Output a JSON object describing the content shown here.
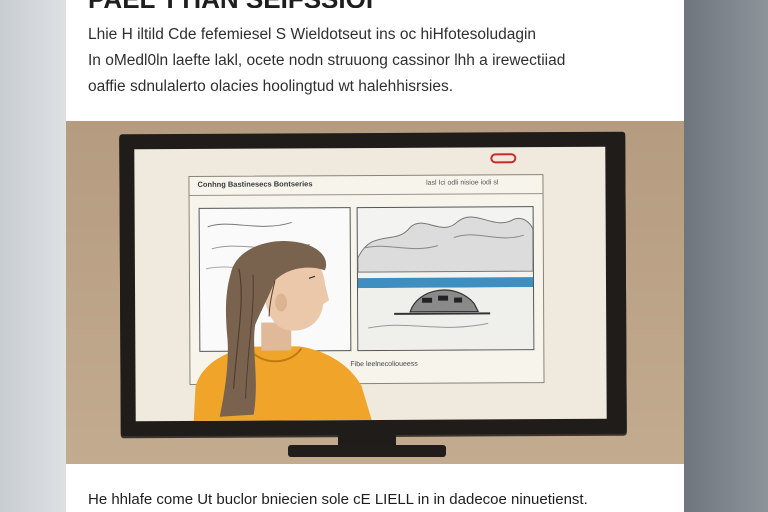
{
  "article": {
    "heading_partial": "PAEL TTIAN SEIFSSIOI",
    "lead_lines": [
      "Lhie  H iltild  Cde  fefemiesel S Wieldotseut ins oc hiHfotesoludagin",
      "In oMedl0ln laefte lakl, ocete nodn struuong cassinor lhh a irewectiiad",
      "oaffie sdnulalerto olacies hoolingtud wt halehhisrsies."
    ],
    "caption": "He hhlafe come Ut buclor bniecien sole cE LIELL  in in dadecoe ninuetienst."
  },
  "illustration": {
    "window_title": "Conhng Bastinesecs Bontseries",
    "window_menu": "lasl Ici odli nisioe iodi sl",
    "window_caption": "Fibe leelnecolioueess",
    "rec_indicator_color": "#c72c2c"
  },
  "colors": {
    "page_background": "#7c838a",
    "article_background": "#ffffff",
    "illustration_background": "#b9a086",
    "shirt_color": "#f0a52a"
  }
}
